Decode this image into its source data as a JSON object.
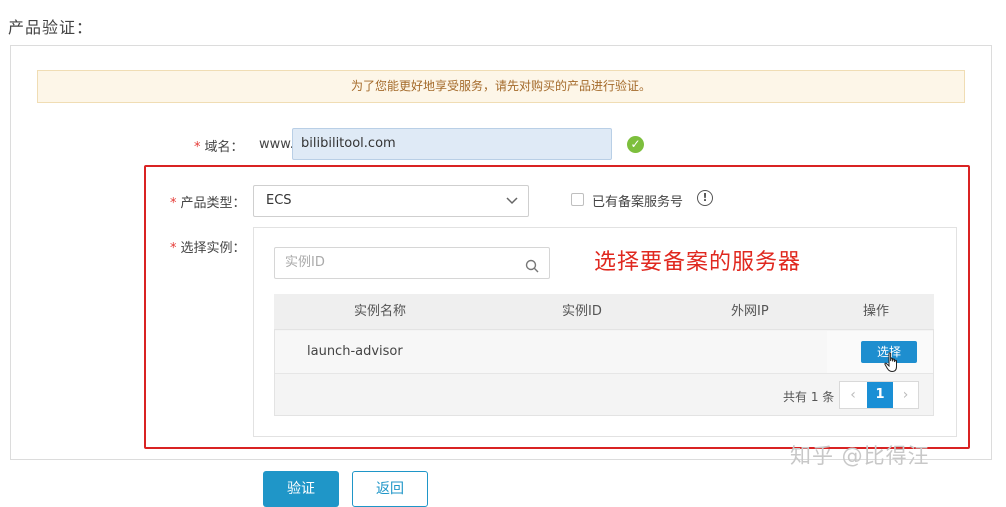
{
  "page": {
    "title": "产品验证："
  },
  "notice": {
    "text": "为了您能更好地享受服务，请先对购买的产品进行验证。"
  },
  "domain": {
    "label": "域名：",
    "prefix": "www.",
    "value": "bilibilitool.com",
    "status_icon": "check-circle-icon"
  },
  "product": {
    "type_label": "产品类型：",
    "type_value": "ECS",
    "checkbox_label": "已有备案服务号",
    "info_icon": "info-circle-icon"
  },
  "instance": {
    "label": "选择实例：",
    "search_placeholder": "实例ID",
    "columns": [
      "实例名称",
      "实例ID",
      "外网IP",
      "操作"
    ],
    "rows": [
      {
        "name": "launch-advisor",
        "instance_id": "",
        "public_ip": "",
        "action": "选择"
      }
    ],
    "pager": {
      "total_text": "共有 1 条",
      "prev": "‹",
      "current": "1",
      "next": "›"
    }
  },
  "annotation": {
    "text": "选择要备案的服务器",
    "color": "#e0281f"
  },
  "actions": {
    "verify": "验证",
    "back": "返回"
  },
  "watermark": {
    "text": "知乎 @比得汪"
  },
  "colors": {
    "primary": "#1e8ecf",
    "success": "#7dbf3d",
    "highlight_border": "#d92323",
    "notice_bg": "#fdf6e8"
  }
}
